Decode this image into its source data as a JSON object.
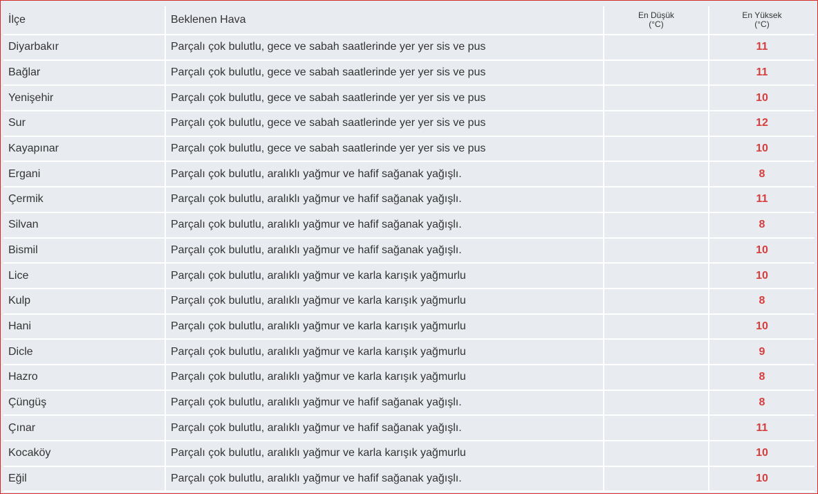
{
  "colors": {
    "frame_border": "#d62a2a",
    "row_background": "#e8ecf0",
    "max_temp_text": "#d63d3d"
  },
  "table": {
    "headers": {
      "district": "İlçe",
      "weather": "Beklenen Hava",
      "min_temp_line1": "En Düşük",
      "min_temp_line2": "(°C)",
      "max_temp_line1": "En Yüksek",
      "max_temp_line2": "(°C)"
    },
    "rows": [
      {
        "district": "Diyarbakır",
        "weather": "Parçalı çok bulutlu, gece ve sabah saatlerinde yer yer sis ve pus",
        "min": "",
        "max": "11"
      },
      {
        "district": "Bağlar",
        "weather": "Parçalı çok bulutlu, gece ve sabah saatlerinde yer yer sis ve pus",
        "min": "",
        "max": "11"
      },
      {
        "district": "Yenişehir",
        "weather": "Parçalı çok bulutlu, gece ve sabah saatlerinde yer yer sis ve pus",
        "min": "",
        "max": "10"
      },
      {
        "district": "Sur",
        "weather": "Parçalı çok bulutlu, gece ve sabah saatlerinde yer yer sis ve pus",
        "min": "",
        "max": "12"
      },
      {
        "district": "Kayapınar",
        "weather": "Parçalı çok bulutlu, gece ve sabah saatlerinde yer yer sis ve pus",
        "min": "",
        "max": "10"
      },
      {
        "district": "Ergani",
        "weather": "Parçalı çok bulutlu, aralıklı yağmur ve hafif sağanak yağışlı.",
        "min": "",
        "max": "8"
      },
      {
        "district": "Çermik",
        "weather": "Parçalı çok bulutlu, aralıklı yağmur ve hafif sağanak yağışlı.",
        "min": "",
        "max": "11"
      },
      {
        "district": "Silvan",
        "weather": "Parçalı çok bulutlu, aralıklı yağmur ve hafif sağanak yağışlı.",
        "min": "",
        "max": "8"
      },
      {
        "district": "Bismil",
        "weather": "Parçalı çok bulutlu, aralıklı yağmur ve hafif sağanak yağışlı.",
        "min": "",
        "max": "10"
      },
      {
        "district": "Lice",
        "weather": "Parçalı çok bulutlu, aralıklı yağmur ve karla karışık yağmurlu",
        "min": "",
        "max": "10"
      },
      {
        "district": "Kulp",
        "weather": "Parçalı çok bulutlu, aralıklı yağmur ve karla karışık yağmurlu",
        "min": "",
        "max": "8"
      },
      {
        "district": "Hani",
        "weather": "Parçalı çok bulutlu, aralıklı yağmur ve karla karışık yağmurlu",
        "min": "",
        "max": "10"
      },
      {
        "district": "Dicle",
        "weather": "Parçalı çok bulutlu, aralıklı yağmur ve karla karışık yağmurlu",
        "min": "",
        "max": "9"
      },
      {
        "district": "Hazro",
        "weather": "Parçalı çok bulutlu, aralıklı yağmur ve karla karışık yağmurlu",
        "min": "",
        "max": "8"
      },
      {
        "district": "Çüngüş",
        "weather": "Parçalı çok bulutlu, aralıklı yağmur ve hafif sağanak yağışlı.",
        "min": "",
        "max": "8"
      },
      {
        "district": "Çınar",
        "weather": "Parçalı çok bulutlu, aralıklı yağmur ve hafif sağanak yağışlı.",
        "min": "",
        "max": "11"
      },
      {
        "district": "Kocaköy",
        "weather": "Parçalı çok bulutlu, aralıklı yağmur ve karla karışık yağmurlu",
        "min": "",
        "max": "10"
      },
      {
        "district": "Eğil",
        "weather": "Parçalı çok bulutlu, aralıklı yağmur ve hafif sağanak yağışlı.",
        "min": "",
        "max": "10"
      }
    ]
  }
}
